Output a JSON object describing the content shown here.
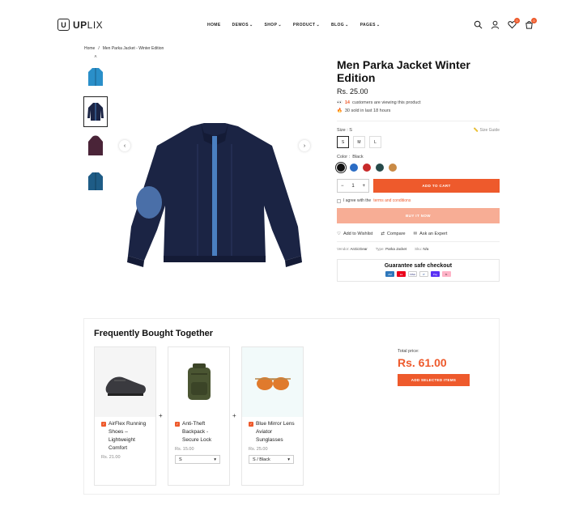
{
  "brand": {
    "mark": "U",
    "name_bold": "UP",
    "name_rest": "LIX"
  },
  "nav": [
    {
      "label": "HOME",
      "dropdown": false
    },
    {
      "label": "DEMOS",
      "dropdown": true
    },
    {
      "label": "SHOP",
      "dropdown": true
    },
    {
      "label": "PRODUCT",
      "dropdown": true
    },
    {
      "label": "BLOG",
      "dropdown": true
    },
    {
      "label": "PAGES",
      "dropdown": true
    }
  ],
  "header_icons": {
    "wishlist_count": "0",
    "cart_count": "0"
  },
  "breadcrumb": {
    "home": "Home",
    "sep": "/",
    "current": "Men Parka Jacket - Winter Edition"
  },
  "product": {
    "title": "Men Parka Jacket Winter Edition",
    "price": "Rs. 25.00",
    "viewing_count": "14",
    "viewing_text": "customers are viewing this product",
    "sold_text": "30 sold in last 18 hours",
    "size_label": "Size :",
    "size_selected": "S",
    "size_guide": "Size Guide",
    "sizes": [
      "S",
      "M",
      "L"
    ],
    "color_label": "Color :",
    "color_selected": "Black",
    "colors": [
      "#111111",
      "#2b6cc4",
      "#c72a2a",
      "#264a4a",
      "#c98a45"
    ],
    "qty": "1",
    "add_to_cart": "ADD TO CART",
    "agree_text": "I agree with the",
    "agree_link": "terms and conditions",
    "buy_now": "BUY IT NOW",
    "wishlist": "Add to Wishlist",
    "compare": "Compare",
    "expert": "Ask an Expert",
    "vendor_label": "Vendor:",
    "vendor": "ArcticGear",
    "type_label": "Type:",
    "type": "Parka Jacket",
    "sku_label": "Sku:",
    "sku": "N/a",
    "guarantee": "Guarantee safe checkout",
    "payments": [
      {
        "name": "amex-icon",
        "color": "#2e77bb"
      },
      {
        "name": "mastercard-icon",
        "color": "#eb001b"
      },
      {
        "name": "visa-icon",
        "color": "#ffffff"
      },
      {
        "name": "paypal-icon",
        "color": "#ffffff"
      },
      {
        "name": "gpay-icon",
        "color": "#5a31f4"
      },
      {
        "name": "klarna-icon",
        "color": "#ffb3c7"
      }
    ]
  },
  "fbt": {
    "title": "Frequently Bought Together",
    "items": [
      {
        "name": "AirFlex Running Shoes – Lightweight Comfort",
        "price": "Rs. 21.00",
        "variant": ""
      },
      {
        "name": "Anti-Theft Backpack - Secure Lock",
        "price": "Rs. 15.00",
        "variant": "S"
      },
      {
        "name": "Blue Mirror Lens Aviator Sunglasses",
        "price": "Rs. 25.00",
        "variant": "S / Black"
      }
    ],
    "total_label": "Total price:",
    "total_price": "Rs. 61.00",
    "add_selected": "ADD SELECTED ITEMS"
  }
}
